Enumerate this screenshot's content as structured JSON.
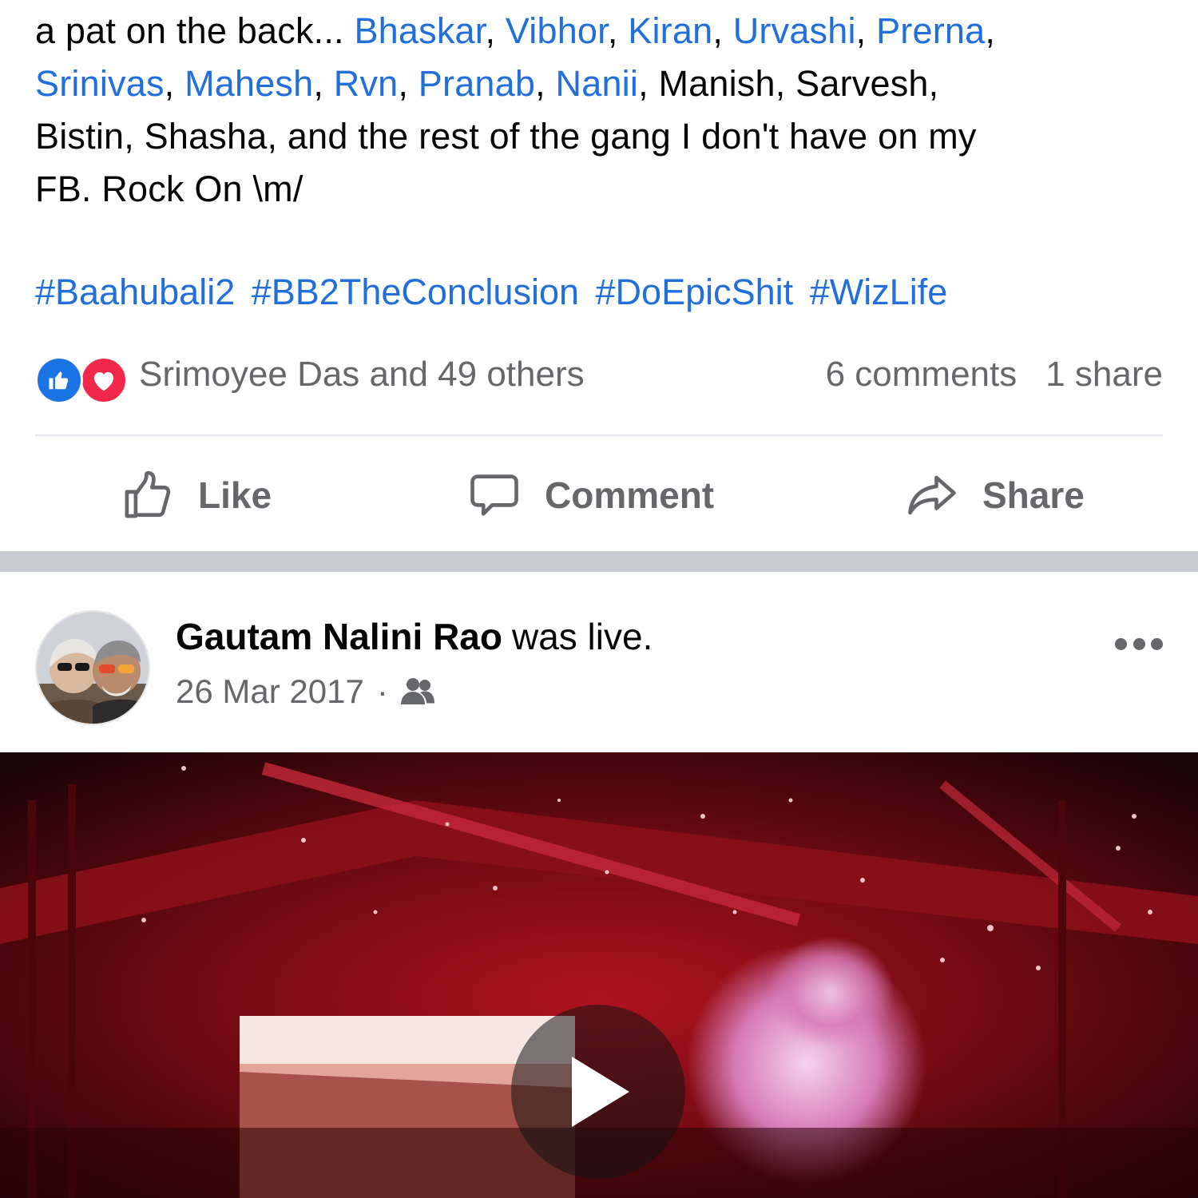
{
  "post1": {
    "text_line1_prefix": "a pat on the back... ",
    "line1_links": [
      "Bhaskar",
      "Vibhor",
      "Kiran",
      "Urvashi",
      "Prerna"
    ],
    "line2_links": [
      "Srinivas",
      "Mahesh",
      "Rvn",
      "Pranab",
      "Nanii"
    ],
    "line2_suffix": ", Manish, Sarvesh,",
    "line3": "Bistin, Shasha, and the rest of the gang I don't have on my",
    "line4": "FB. Rock On \\m/",
    "hashtags": [
      "#Baahubali2",
      "#BB2TheConclusion",
      "#DoEpicShit",
      "#WizLife"
    ],
    "reactions": {
      "icons": [
        "like-reaction-icon",
        "love-reaction-icon"
      ],
      "reactors_text": "Srimoyee Das and 49 others",
      "comments_text": "6 comments",
      "shares_text": "1 share"
    },
    "actions": {
      "like_label": "Like",
      "comment_label": "Comment",
      "share_label": "Share"
    }
  },
  "post2": {
    "author": "Gautam Nalini Rao",
    "action_text": "was live.",
    "date": "26 Mar 2017",
    "separator": "·",
    "audience_icon": "friends-icon",
    "more_icon": "more-options-icon",
    "video_play_icon": "play-icon"
  },
  "colors": {
    "link": "#216FDB",
    "secondary_text": "#65676B",
    "like_blue": "#1B74E4",
    "love_red": "#F0284A",
    "feed_separator": "#C9CCD1"
  }
}
